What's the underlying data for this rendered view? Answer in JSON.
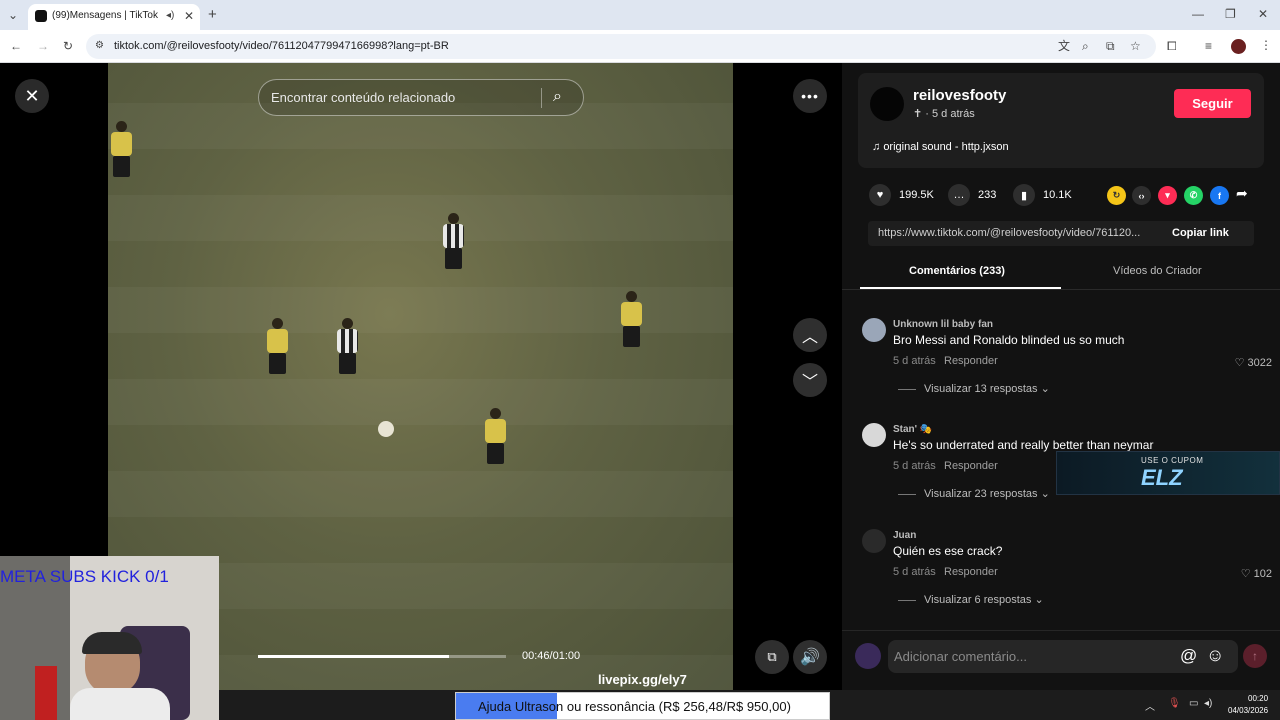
{
  "browser": {
    "tab_title": "(99)Mensagens | TikTok",
    "new_tab_label": "+",
    "url": "tiktok.com/@reilovesfooty/video/7611204779947166998?lang=pt-BR"
  },
  "video": {
    "search_placeholder": "Encontrar conteúdo relacionado",
    "current_time": "00:46/01:00",
    "progress": 0.77
  },
  "creator": {
    "username": "reilovesfooty",
    "meta": "✝ · 5 d atrás",
    "follow_label": "Seguir",
    "sound": "original sound - http.jxson"
  },
  "stats": {
    "likes": "199.5K",
    "comments": "233",
    "saves": "10.1K"
  },
  "share": {
    "link": "https://www.tiktok.com/@reilovesfooty/video/761120...",
    "copy_label": "Copiar link"
  },
  "tabs": {
    "comments": "Comentários (233)",
    "videos": "Vídeos do Criador"
  },
  "comments": [
    {
      "user": "Unknown lil baby fan",
      "text": "Bro Messi and Ronaldo blinded us so much",
      "time": "5 d atrás",
      "reply": "Responder",
      "likes": "♡ 3022",
      "view": "Visualizar 13 respostas ⌄"
    },
    {
      "user": "Stan' 🎭",
      "text": "He's so underrated and really better than neymar",
      "time": "5 d atrás",
      "reply": "Responder",
      "likes": "",
      "view": "Visualizar 23 respostas ⌄"
    },
    {
      "user": "Juan",
      "text": "Quién es ese crack?",
      "time": "5 d atrás",
      "reply": "Responder",
      "likes": "♡ 102",
      "view": "Visualizar 6 respostas ⌄"
    }
  ],
  "comment_input": {
    "placeholder": "Adicionar comentário...",
    "at": "@",
    "emoji": "☺",
    "send": "↑"
  },
  "overlays": {
    "subs_goal": "META SUBS KICK 0/1",
    "coupon_small": "USE O CUPOM",
    "coupon_code": "ELZ",
    "livepix": "livepix.gg/ely7",
    "donation": "Ajuda Ultrason ou ressonância (R$ 256,48/R$ 950,00)",
    "donation_progress": 0.27
  },
  "taskbar": {
    "time": "00:20",
    "date": "04/03/2026"
  },
  "colors": {
    "follow": "#fe2c55",
    "panel_bg": "#121212"
  }
}
